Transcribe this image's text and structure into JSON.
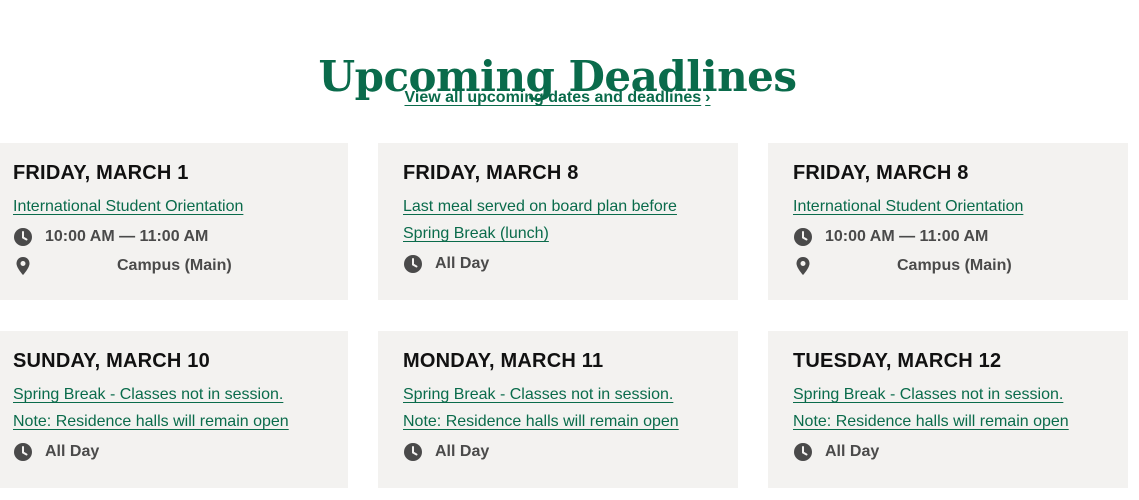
{
  "header": {
    "title": "Upcoming Deadlines",
    "view_all_label": "View all upcoming dates and deadlines",
    "chevron": "›"
  },
  "cards": [
    {
      "date": "FRIDAY, MARCH 1",
      "event_lines": [
        "International Student Orientation"
      ],
      "time": "10:00 AM — 11:00 AM",
      "location": "Campus (Main)"
    },
    {
      "date": "FRIDAY, MARCH 8",
      "event_lines": [
        "Last meal served on board plan before",
        "Spring Break (lunch)"
      ],
      "time": "All Day"
    },
    {
      "date": "FRIDAY, MARCH 8",
      "event_lines": [
        "International Student Orientation"
      ],
      "time": "10:00 AM — 11:00 AM",
      "location": "Campus (Main)"
    },
    {
      "date": "SUNDAY, MARCH 10",
      "event_lines": [
        "Spring Break - Classes not in session.",
        "Note: Residence halls will remain open"
      ],
      "time": "All Day"
    },
    {
      "date": "MONDAY, MARCH 11",
      "event_lines": [
        "Spring Break - Classes not in session.",
        "Note: Residence halls will remain open"
      ],
      "time": "All Day"
    },
    {
      "date": "TUESDAY, MARCH 12",
      "event_lines": [
        "Spring Break - Classes not in session.",
        "Note: Residence halls will remain open"
      ],
      "time": "All Day"
    }
  ],
  "icons": {
    "time": "clock-icon",
    "location": "map-pin-icon"
  },
  "colors": {
    "accent": "#0a6b4b",
    "card_bg": "#f3f2f0",
    "icon": "#4a4a4a"
  }
}
